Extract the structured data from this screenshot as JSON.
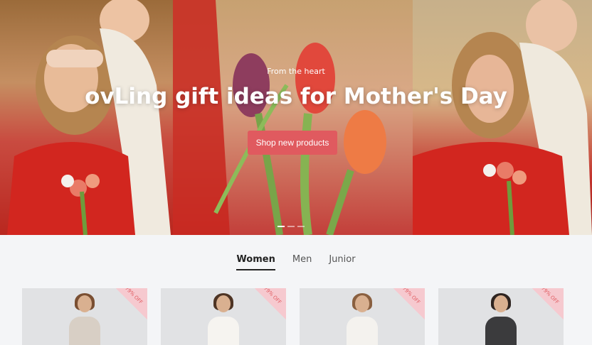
{
  "hero": {
    "tagline": "From the heart",
    "title": "ovLing gift ideas for Mother's Day",
    "cta_label": "Shop new products"
  },
  "tabs": [
    {
      "label": "Women",
      "active": true
    },
    {
      "label": "Men",
      "active": false
    },
    {
      "label": "Junior",
      "active": false
    }
  ],
  "products": [
    {
      "badge": "79% OFF"
    },
    {
      "badge": "79% OFF"
    },
    {
      "badge": "79% OFF"
    },
    {
      "badge": "79% OFF"
    }
  ],
  "colors": {
    "accent": "#e05a5f"
  }
}
